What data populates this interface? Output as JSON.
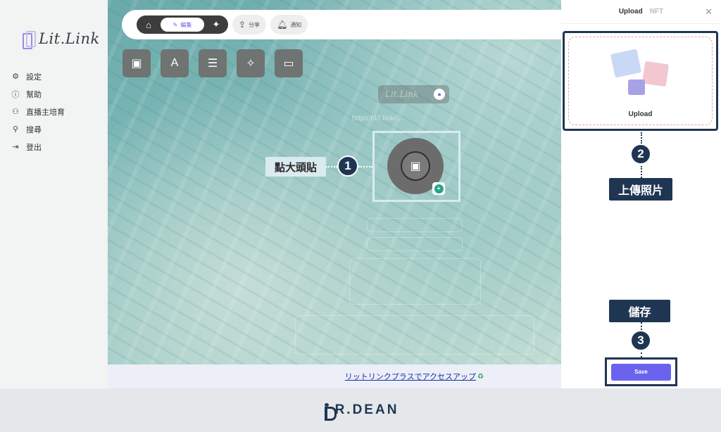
{
  "sidebar": {
    "logo": "Lit.Link",
    "items": [
      {
        "icon": "gear-icon",
        "label": "設定"
      },
      {
        "icon": "help-circle-icon",
        "label": "幫助"
      },
      {
        "icon": "users-icon",
        "label": "直播主培育"
      },
      {
        "icon": "search-icon",
        "label": "搜尋"
      },
      {
        "icon": "logout-icon",
        "label": "登出"
      }
    ]
  },
  "toolbar": {
    "edit_label": "編集",
    "share_label": "分享",
    "notify_label": "通知"
  },
  "tools": [
    "image-add-icon",
    "text-block-icon",
    "list-icon",
    "sparkle-icon",
    "display-icon"
  ],
  "profile": {
    "name": "Lit.Link",
    "url": "https://lit.link/..."
  },
  "callouts": {
    "step1_label": "點大頭貼",
    "step1_num": "1",
    "step2_label": "上傳照片",
    "step2_num": "2",
    "step3_label": "儲存",
    "step3_num": "3"
  },
  "banner": {
    "link_text": "リットリンクプラスでアクセスアップ"
  },
  "panel": {
    "tab_upload": "Upload",
    "tab_nft": "NFT",
    "upload_label": "Upload",
    "save_label": "Save"
  },
  "footer": {
    "brand_text": "R.DEAN"
  },
  "colors": {
    "accent": "#6a63ee",
    "navy": "#1f3652",
    "callout_bg": "#d9ebef",
    "lock_green": "#2aa38c"
  }
}
